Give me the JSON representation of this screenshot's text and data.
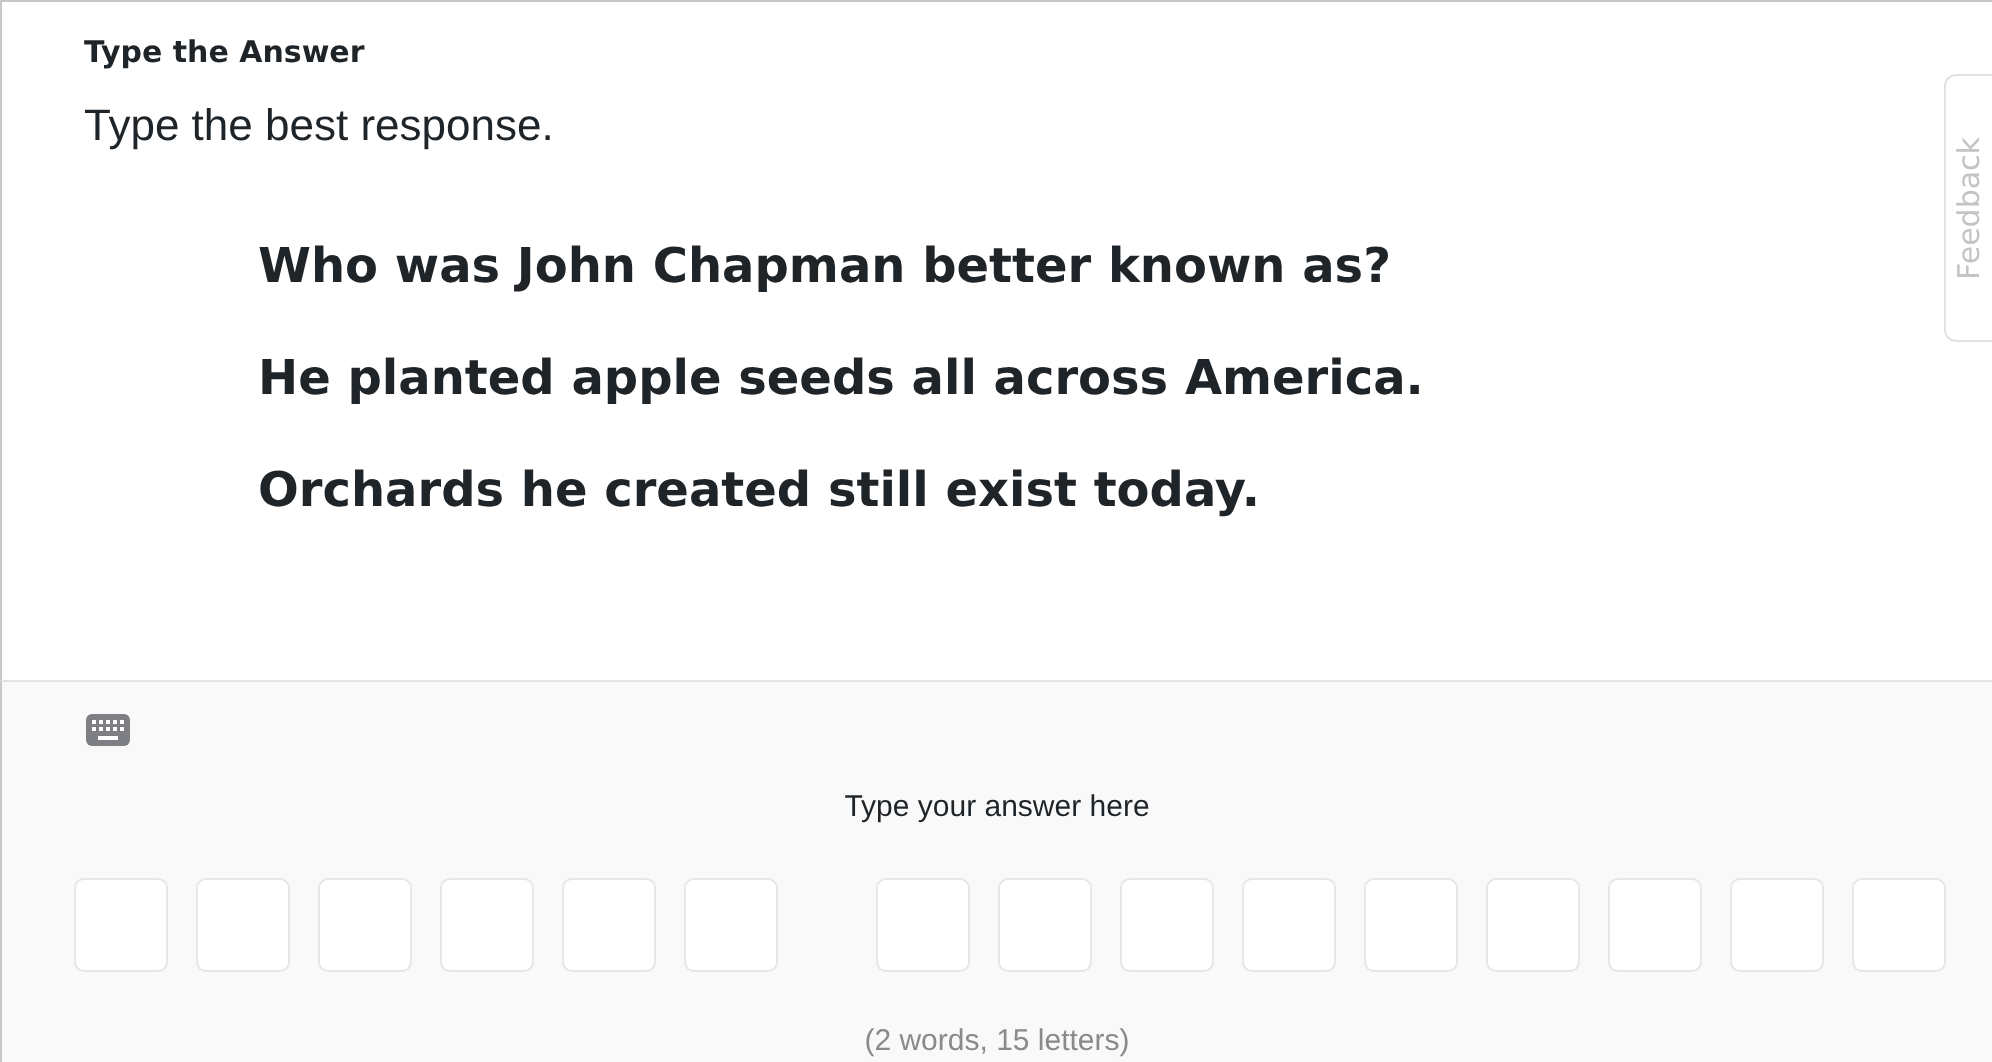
{
  "header": {
    "title": "Type the Answer",
    "instruction": "Type the best response."
  },
  "question_lines": [
    "Who was John Chapman better known as?",
    "He planted apple seeds all across America.",
    "Orchards he created still exist today."
  ],
  "feedback_tab": {
    "label": "Feedback"
  },
  "answer": {
    "prompt": "Type your answer here",
    "hint": "(2 words, 15 letters)",
    "words": [
      {
        "boxes": [
          {
            "filled": false
          },
          {
            "filled": false
          },
          {
            "filled": false
          },
          {
            "filled": false
          },
          {
            "filled": false
          },
          {
            "filled": false
          }
        ]
      },
      {
        "boxes": [
          {
            "filled": false
          },
          {
            "filled": false
          },
          {
            "filled": false
          },
          {
            "filled": false
          },
          {
            "filled": false
          },
          {
            "filled": false
          },
          {
            "filled": false
          },
          {
            "filled": false
          },
          {
            "filled": false
          }
        ]
      }
    ]
  }
}
